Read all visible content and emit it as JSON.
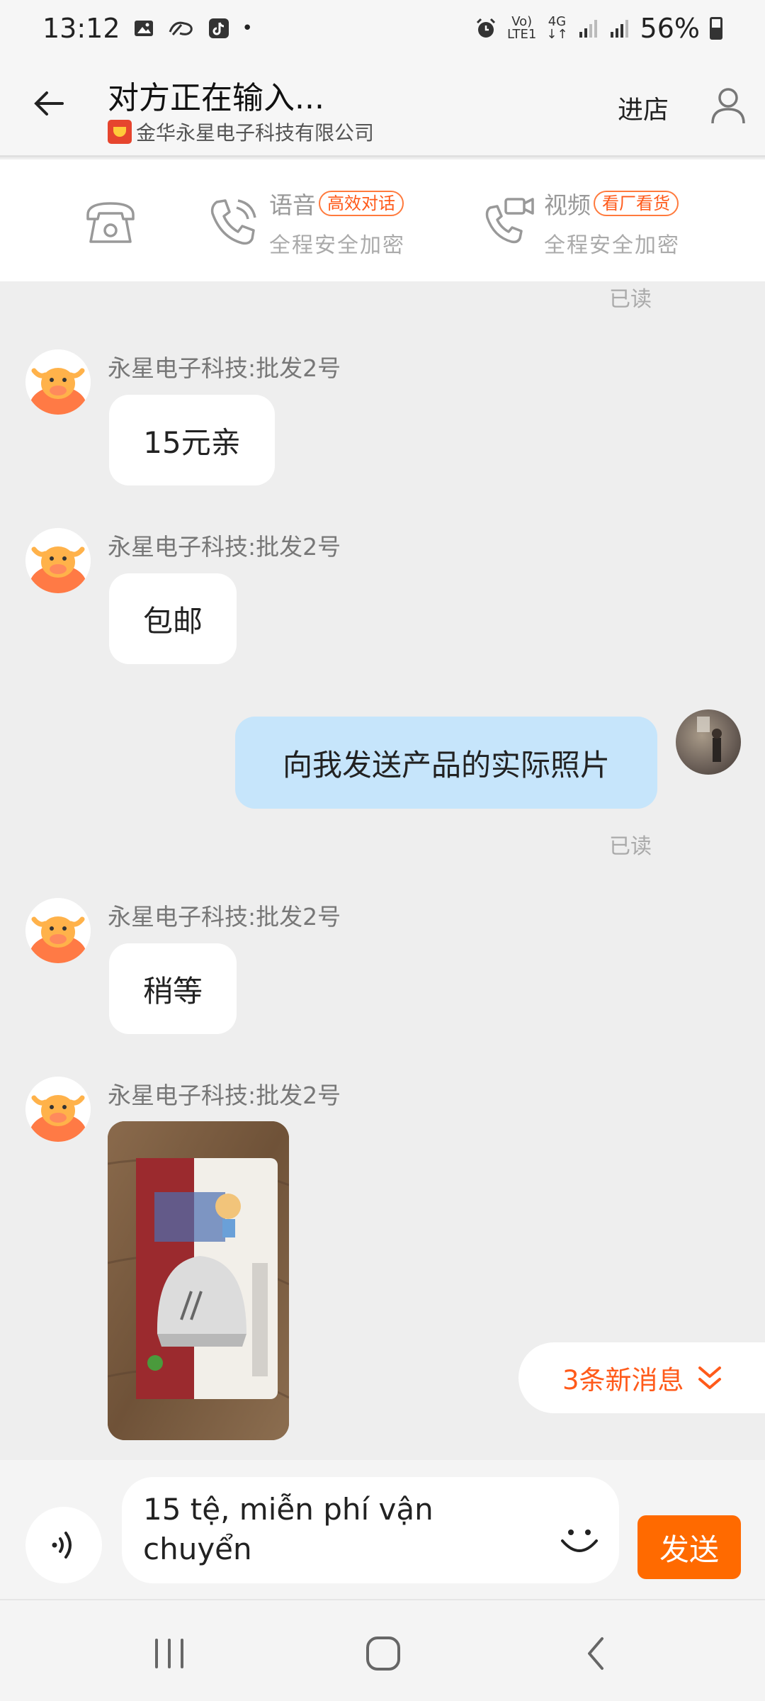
{
  "status_bar": {
    "time": "13:12",
    "dot": "•",
    "volte_top": "Vo)",
    "volte_bottom": "LTE1",
    "net_top": "4G",
    "net_bottom": "↓↑",
    "battery": "56%",
    "icons": [
      "image-icon",
      "whistle-icon",
      "tiktok-icon",
      "alarm-icon",
      "signal-icon",
      "battery-icon"
    ]
  },
  "header": {
    "title": "对方正在输入...",
    "company": "金华永星电子科技有限公司",
    "enter_shop": "进店"
  },
  "call_strip": {
    "voice_label": "语音",
    "voice_pill": "高效对话",
    "voice_sub": "全程安全加密",
    "video_label": "视频",
    "video_pill": "看厂看货",
    "video_sub": "全程安全加密"
  },
  "chat": {
    "read_label": "已读",
    "sender_name": "永星电子科技:批发2号",
    "messages": [
      {
        "text": "15元亲"
      },
      {
        "text": "包邮"
      },
      {
        "text": "向我发送产品的实际照片"
      },
      {
        "text": "稍等"
      }
    ],
    "new_messages": "3条新消息"
  },
  "input": {
    "value": "15 tệ, miễn phí vận chuyển",
    "send_label": "发送"
  },
  "colors": {
    "accent": "#ff6a00",
    "my_bubble": "#c6e5fb",
    "chat_bg": "#eeeeee"
  }
}
